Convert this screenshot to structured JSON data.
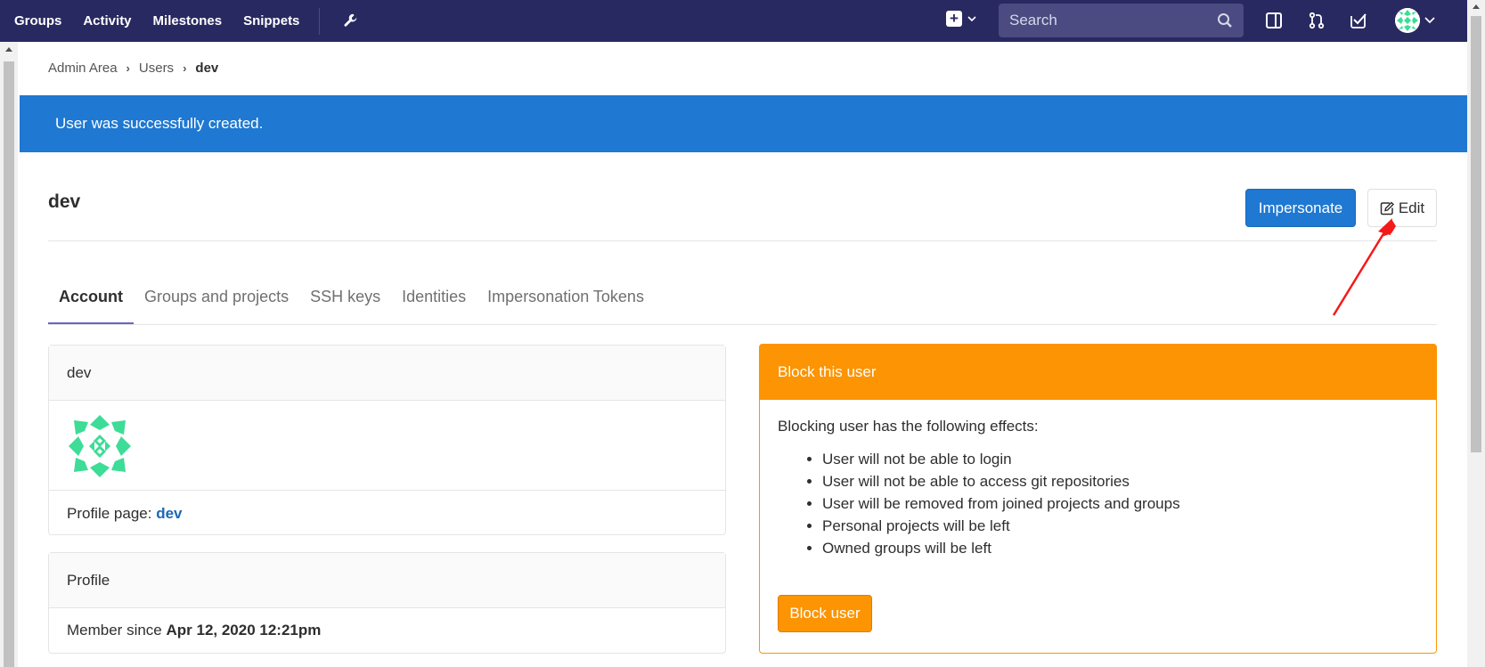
{
  "nav": {
    "links": [
      "Groups",
      "Activity",
      "Milestones",
      "Snippets"
    ],
    "search_placeholder": "Search"
  },
  "breadcrumb": {
    "items": [
      "Admin Area",
      "Users"
    ],
    "current": "dev"
  },
  "flash": {
    "message": "User was successfully created."
  },
  "header": {
    "title": "dev",
    "impersonate_label": "Impersonate",
    "edit_label": "Edit"
  },
  "tabs": [
    "Account",
    "Groups and projects",
    "SSH keys",
    "Identities",
    "Impersonation Tokens"
  ],
  "user_card": {
    "name": "dev",
    "profile_page_label": "Profile page:",
    "profile_page_link": "dev"
  },
  "profile_card": {
    "title": "Profile",
    "member_since_label": "Member since",
    "member_since_value": "Apr 12, 2020 12:21pm"
  },
  "block_card": {
    "title": "Block this user",
    "intro": "Blocking user has the following effects:",
    "effects": [
      "User will not be able to login",
      "User will not be able to access git repositories",
      "User will be removed from joined projects and groups",
      "Personal projects will be left",
      "Owned groups will be left"
    ],
    "button_label": "Block user"
  },
  "colors": {
    "navbar": "#292961",
    "primary": "#1f78d1",
    "warning": "#fc9403",
    "avatar": "#3ddc97"
  }
}
